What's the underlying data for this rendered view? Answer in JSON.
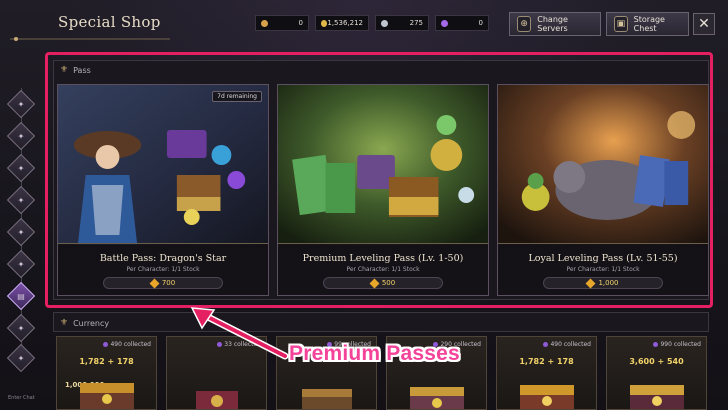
{
  "header": {
    "title": "Special Shop",
    "currencies": [
      {
        "icon": "arrow-token-icon",
        "value": "0",
        "color": "#d8a24a"
      },
      {
        "icon": "gold-coin-icon",
        "value": "1,536,212",
        "color": "#e0b84a"
      },
      {
        "icon": "silver-coin-icon",
        "value": "275",
        "color": "#bfc6d0"
      },
      {
        "icon": "purple-gem-icon",
        "value": "0",
        "color": "#a56ae8"
      }
    ],
    "change_servers_label": "Change Servers",
    "storage_chest_label": "Storage Chest",
    "close_symbol": "✕"
  },
  "sidebar": {
    "items": [
      {
        "icon": "diamond-tab-icon"
      },
      {
        "icon": "diamond-tab-icon"
      },
      {
        "icon": "diamond-tab-icon"
      },
      {
        "icon": "diamond-tab-icon"
      },
      {
        "icon": "diamond-tab-icon"
      },
      {
        "icon": "diamond-tab-icon"
      },
      {
        "icon": "shop-tab-icon",
        "active": true
      },
      {
        "icon": "diamond-tab-icon"
      },
      {
        "icon": "diamond-tab-icon"
      }
    ],
    "footer_text": "Enter   Chat"
  },
  "pass_section": {
    "heading": "Pass",
    "cards": [
      {
        "name": "Battle Pass: Dragon's Star",
        "stock": "Per Character:  1/1 Stock",
        "price": "700",
        "badge": "7d remaining",
        "art_colors": [
          "#2a3a5a",
          "#6b5a8a",
          "#1a1e2e"
        ]
      },
      {
        "name": "Premium Leveling Pass (Lv. 1-50)",
        "stock": "Per Character:  1/1 Stock",
        "price": "500",
        "art_colors": [
          "#3a5a2a",
          "#8aa04a",
          "#1c2414"
        ]
      },
      {
        "name": "Loyal Leveling Pass (Lv. 51-55)",
        "stock": "Per Character:  1/1 Stock",
        "price": "1,000",
        "art_colors": [
          "#5a3a24",
          "#c07a3a",
          "#241810"
        ]
      }
    ]
  },
  "currency_section": {
    "heading": "Currency",
    "cards": [
      {
        "collected": "490 collected",
        "amount": "1,782 + 178",
        "sub": "1,000,000"
      },
      {
        "collected": "33 collected",
        "amount": ""
      },
      {
        "collected": "99 collected",
        "amount": ""
      },
      {
        "collected": "290 collected",
        "amount": ""
      },
      {
        "collected": "490 collected",
        "amount": "1,782 + 178"
      },
      {
        "collected": "990 collected",
        "amount": "3,600 + 540"
      }
    ]
  },
  "annotation": {
    "label": "Premium Passes",
    "color": "#e52062"
  }
}
